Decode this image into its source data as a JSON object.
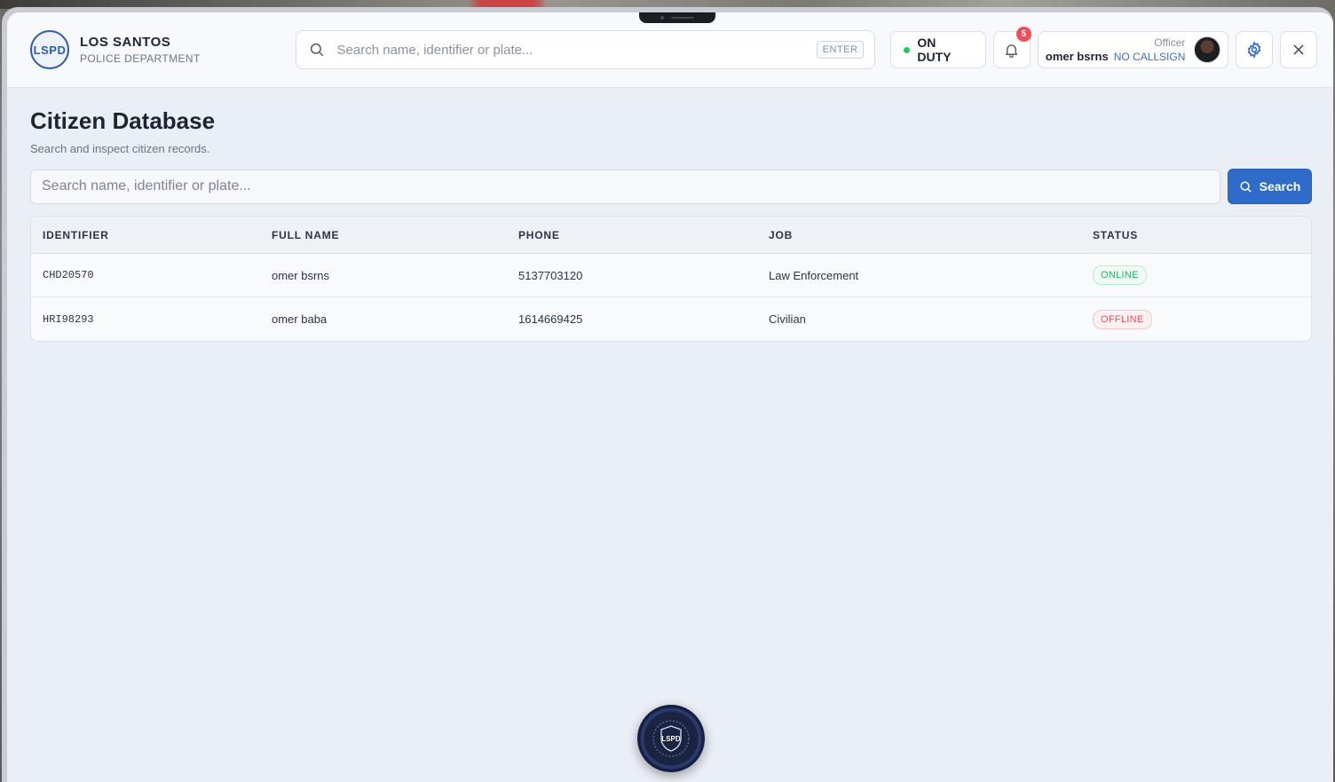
{
  "header": {
    "logo_text": "LSPD",
    "title": "LOS SANTOS",
    "subtitle": "POLICE DEPARTMENT",
    "search_placeholder": "Search name, identifier or plate...",
    "search_shortcut": "ENTER",
    "duty_status": "ON DUTY",
    "notification_count": "5",
    "officer": {
      "role": "Officer",
      "name": "omer bsrns",
      "callsign": "NO CALLSIGN"
    }
  },
  "main": {
    "title": "Citizen Database",
    "subtitle": "Search and inspect citizen records.",
    "search_placeholder": "Search name, identifier or plate...",
    "search_button": "Search",
    "table": {
      "headers": [
        "IDENTIFIER",
        "FULL NAME",
        "PHONE",
        "JOB",
        "STATUS"
      ],
      "rows": [
        {
          "identifier": "CHD20570",
          "name": "omer bsrns",
          "phone": "5137703120",
          "job": "Law Enforcement",
          "status": "ONLINE"
        },
        {
          "identifier": "HRI98293",
          "name": "omer baba",
          "phone": "1614669425",
          "job": "Civilian",
          "status": "OFFLINE"
        }
      ]
    }
  },
  "fab": {
    "label": "LSPD"
  },
  "colors": {
    "accent": "#2f6bc8",
    "online": "#22b36a",
    "offline": "#e0535e",
    "duty_dot": "#22c55e",
    "badge": "#ef4f5b"
  }
}
